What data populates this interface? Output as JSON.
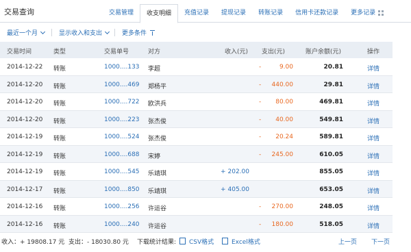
{
  "header": {
    "title": "交易查询",
    "tabs": [
      {
        "label": "交易管理",
        "active": false
      },
      {
        "label": "收支明细",
        "active": true
      },
      {
        "label": "充值记录",
        "active": false
      },
      {
        "label": "提现记录",
        "active": false
      },
      {
        "label": "转账记录",
        "active": false
      },
      {
        "label": "信用卡还款记录",
        "active": false
      },
      {
        "label": "更多记录",
        "active": false
      }
    ]
  },
  "filters": {
    "period": "最近一个月",
    "show": "显示收入和支出",
    "more": "更多条件"
  },
  "columns": [
    "交易时间",
    "类型",
    "交易单号",
    "对方",
    "收入(元)",
    "支出(元)",
    "账户余额(元)",
    "操作"
  ],
  "rows": [
    {
      "date": "2014-12-22",
      "type": "转账",
      "id": "1000....133",
      "party": "李超",
      "income": "",
      "expense": "9.00",
      "balance": "20.81",
      "action": "详情"
    },
    {
      "date": "2014-12-20",
      "type": "转账",
      "id": "1000....469",
      "party": "郑杨平",
      "income": "",
      "expense": "440.00",
      "balance": "29.81",
      "action": "详情"
    },
    {
      "date": "2014-12-20",
      "type": "转账",
      "id": "1000....722",
      "party": "欧洪兵",
      "income": "",
      "expense": "80.00",
      "balance": "469.81",
      "action": "详情"
    },
    {
      "date": "2014-12-20",
      "type": "转账",
      "id": "1000....223",
      "party": "张杰俊",
      "income": "",
      "expense": "40.00",
      "balance": "549.81",
      "action": "详情"
    },
    {
      "date": "2014-12-19",
      "type": "转账",
      "id": "1000....524",
      "party": "张杰俊",
      "income": "",
      "expense": "20.24",
      "balance": "589.81",
      "action": "详情"
    },
    {
      "date": "2014-12-19",
      "type": "转账",
      "id": "1000....688",
      "party": "宋婷",
      "income": "",
      "expense": "245.00",
      "balance": "610.05",
      "action": "详情"
    },
    {
      "date": "2014-12-19",
      "type": "转账",
      "id": "1000....545",
      "party": "乐靖琪",
      "income": "202.00",
      "expense": "",
      "balance": "855.05",
      "action": "详情"
    },
    {
      "date": "2014-12-17",
      "type": "转账",
      "id": "1000....850",
      "party": "乐靖琪",
      "income": "405.00",
      "expense": "",
      "balance": "653.05",
      "action": "详情"
    },
    {
      "date": "2014-12-16",
      "type": "转账",
      "id": "1000....256",
      "party": "许运谷",
      "income": "",
      "expense": "270.00",
      "balance": "248.05",
      "action": "详情"
    },
    {
      "date": "2014-12-16",
      "type": "转账",
      "id": "1000....240",
      "party": "许运谷",
      "income": "",
      "expense": "180.00",
      "balance": "518.05",
      "action": "详情"
    }
  ],
  "footer": {
    "income": "收入：+ 19808.17 元",
    "expense": "支出：- 18030.80 元",
    "download_label": "下载统计结果:",
    "csv": "CSV格式",
    "excel": "Excel格式",
    "prev": "上一页",
    "next": "下一页"
  },
  "colors": {
    "link": "#2b6fb6",
    "expense": "#e8671f",
    "header_bg": "#e9eef4",
    "alt_row": "#f2f5f9"
  }
}
